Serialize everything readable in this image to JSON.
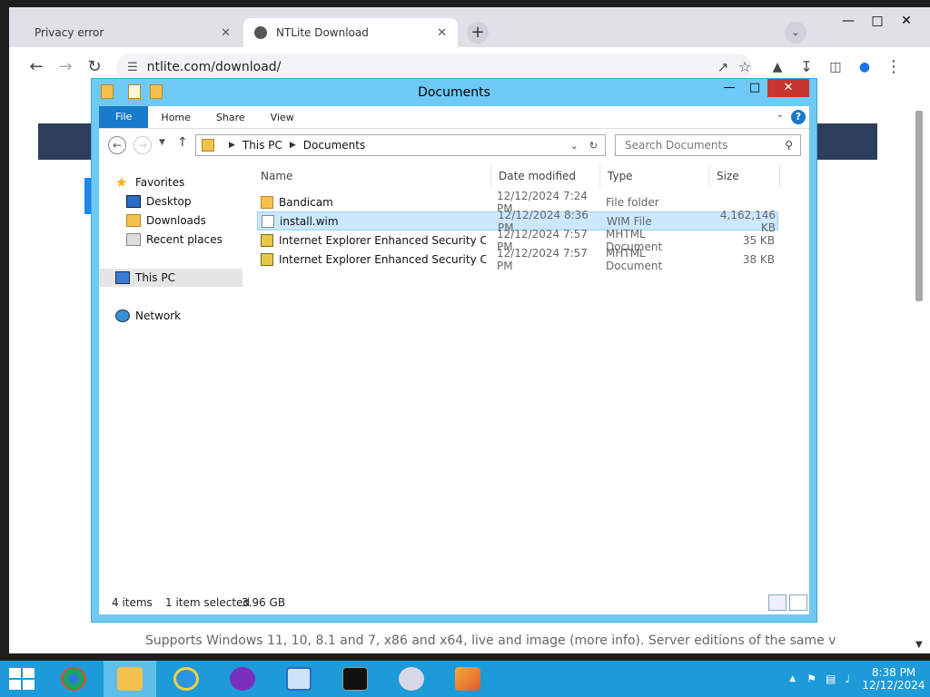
{
  "browser": {
    "tabs": [
      {
        "title": "Privacy error",
        "active": false
      },
      {
        "title": "NTLite Download",
        "active": true
      }
    ],
    "url": "ntlite.com/download/",
    "page_footer_text": "Supports Windows 11, 10, 8.1 and 7, x86 and x64, live and image (more info). Server editions of the same versions"
  },
  "explorer": {
    "title": "Documents",
    "ribbon_tabs": [
      "File",
      "Home",
      "Share",
      "View"
    ],
    "breadcrumb": [
      "This PC",
      "Documents"
    ],
    "search_placeholder": "Search Documents",
    "nav": {
      "favorites": "Favorites",
      "desktop": "Desktop",
      "downloads": "Downloads",
      "recent": "Recent places",
      "this_pc": "This PC",
      "network": "Network"
    },
    "columns": [
      "Name",
      "Date modified",
      "Type",
      "Size"
    ],
    "files": [
      {
        "name": "Bandicam",
        "date": "12/12/2024 7:24 PM",
        "type": "File folder",
        "size": "",
        "icon": "folder-icon",
        "selected": false
      },
      {
        "name": "install.wim",
        "date": "12/12/2024 8:36 PM",
        "type": "WIM File",
        "size": "4,162,146 KB",
        "icon": "document-icon",
        "selected": true
      },
      {
        "name": "Internet Explorer Enhanced Security Conf...",
        "date": "12/12/2024 7:57 PM",
        "type": "MHTML Document",
        "size": "35 KB",
        "icon": "mhtml-icon",
        "selected": false
      },
      {
        "name": "Internet Explorer Enhanced Security Conf...",
        "date": "12/12/2024 7:57 PM",
        "type": "MHTML Document",
        "size": "38 KB",
        "icon": "mhtml-icon",
        "selected": false
      }
    ],
    "status": {
      "items": "4 items",
      "selected": "1 item selected",
      "size": "3.96 GB"
    }
  },
  "taskbar": {
    "apps": [
      "Chrome",
      "File Explorer",
      "Internet Explorer",
      "Media Player",
      "Server Manager",
      "Command Prompt",
      "Disk Tool",
      "NTLite"
    ],
    "time": "8:38 PM",
    "date": "12/12/2024"
  },
  "colors": {
    "explorer_frame": "#6ecaf5",
    "taskbar": "#1d9bd8",
    "selection": "#cce8ff",
    "ribbon_file": "#1979ca",
    "close_button": "#c7372f"
  }
}
